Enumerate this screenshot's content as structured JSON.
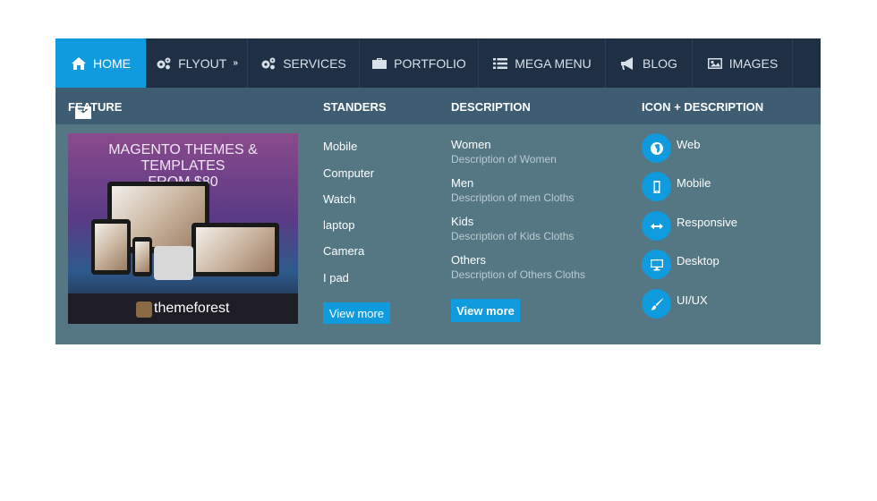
{
  "nav": {
    "items": [
      {
        "label": "HOME",
        "icon": "home-icon"
      },
      {
        "label": "FLYOUT",
        "icon": "gears-icon"
      },
      {
        "label": "SERVICES",
        "icon": "gears-icon"
      },
      {
        "label": "PORTFOLIO",
        "icon": "briefcase-icon"
      },
      {
        "label": "MEGA MENU",
        "icon": "list-icon"
      },
      {
        "label": "BLOG",
        "icon": "bullhorn-icon"
      },
      {
        "label": "IMAGES",
        "icon": "image-icon"
      }
    ]
  },
  "mega": {
    "columns": {
      "feature": "FEATURE",
      "standers": "STANDERS",
      "description": "DESCRIPTION",
      "icon_description": "ICON + DESCRIPTION"
    },
    "banner": {
      "line1": "MAGENTO THEMES & TEMPLATES",
      "line2": "FROM $80",
      "brand": "themeforest"
    },
    "standers": [
      "Mobile",
      "Computer",
      "Watch",
      "laptop",
      "Camera",
      "I pad"
    ],
    "standers_button": "View more",
    "descriptions": [
      {
        "title": "Women",
        "sub": "Description of Women"
      },
      {
        "title": "Men",
        "sub": "Description of men Cloths"
      },
      {
        "title": "Kids",
        "sub": "Description of Kids Cloths"
      },
      {
        "title": "Others",
        "sub": "Description of Others Cloths"
      }
    ],
    "description_button": "View more",
    "icon_items": [
      {
        "label": "Web",
        "icon": "globe-icon"
      },
      {
        "label": "Mobile",
        "icon": "mobile-icon"
      },
      {
        "label": "Responsive",
        "icon": "arrows-h-icon"
      },
      {
        "label": "Desktop",
        "icon": "desktop-icon"
      },
      {
        "label": "UI/UX",
        "icon": "brush-icon"
      }
    ]
  },
  "colors": {
    "accent": "#0f9bde",
    "nav_bg": "#1f3045",
    "panel_bg": "#557783",
    "panel_head": "#3e5d72"
  }
}
